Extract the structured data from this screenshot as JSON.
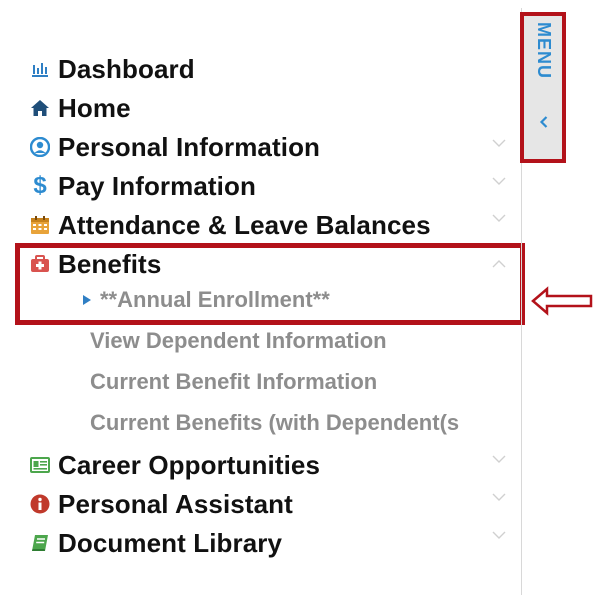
{
  "menu": {
    "items": [
      {
        "label": "Dashboard",
        "icon": "bar-chart-icon",
        "expandable": false
      },
      {
        "label": "Home",
        "icon": "home-icon",
        "expandable": false
      },
      {
        "label": "Personal Information",
        "icon": "user-circle-icon",
        "expandable": true
      },
      {
        "label": "Pay Information",
        "icon": "dollar-icon",
        "expandable": true
      },
      {
        "label": "Attendance & Leave Balances",
        "icon": "calendar-icon",
        "expandable": true
      },
      {
        "label": "Benefits",
        "icon": "medical-kit-icon",
        "expandable": true,
        "expanded": true
      },
      {
        "label": "Career Opportunities",
        "icon": "id-card-icon",
        "expandable": true
      },
      {
        "label": "Personal Assistant",
        "icon": "info-circle-icon",
        "expandable": true
      },
      {
        "label": "Document Library",
        "icon": "book-icon",
        "expandable": true
      }
    ],
    "benefits_subitems": [
      {
        "label": "**Annual Enrollment**",
        "selected": true
      },
      {
        "label": "View Dependent Information"
      },
      {
        "label": "Current Benefit Information"
      },
      {
        "label": "Current Benefits (with Dependent(s"
      }
    ]
  },
  "menu_tab": {
    "label": "MENU",
    "icon": "chevron-left-icon"
  },
  "annotation": {
    "icon": "hollow-left-arrow-icon"
  },
  "colors": {
    "highlight": "#b3121a",
    "text": "#111111",
    "subtext": "#8d8d8d",
    "accent_blue": "#2d8bd0",
    "icon_blue": "#2f7fc4",
    "icon_green": "#4ca64c",
    "icon_orange": "#e8a33a",
    "icon_red": "#d9534f",
    "icon_dark_red": "#c0392b",
    "tab_bg": "#e6e6e6"
  }
}
